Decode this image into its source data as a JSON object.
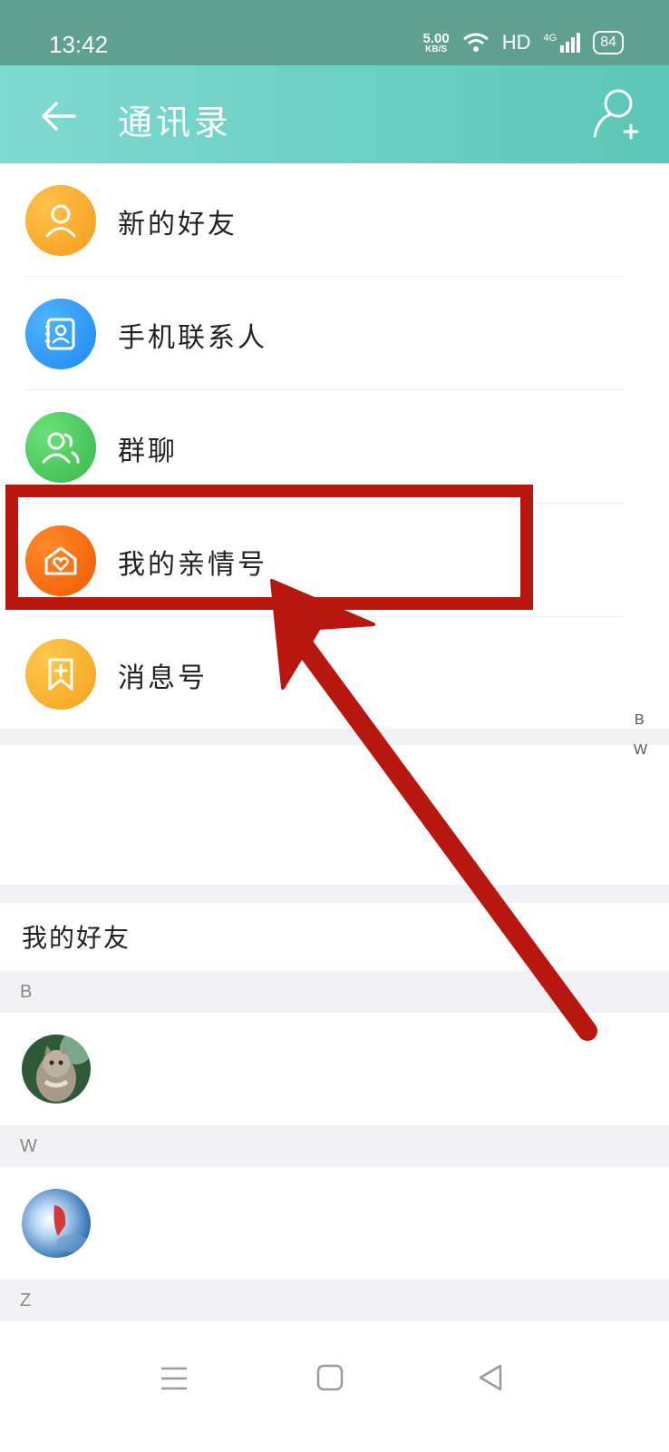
{
  "status_bar": {
    "time": "13:42",
    "net_speed": "5.00",
    "net_unit": "KB/S",
    "hd": "HD",
    "signal": "4G",
    "battery": "84"
  },
  "header": {
    "title": "通讯录",
    "back_icon": "arrow-left-icon",
    "add_icon": "add-contact-icon"
  },
  "menu": [
    {
      "label": "新的好友",
      "icon": "person-icon",
      "color": "#f5a623"
    },
    {
      "label": "手机联系人",
      "icon": "contact-book-icon",
      "color": "#2196f3"
    },
    {
      "label": "群聊",
      "icon": "group-icon",
      "color": "#4cca5c"
    },
    {
      "label": "我的亲情号",
      "icon": "home-heart-icon",
      "color": "#ff6a00"
    },
    {
      "label": "消息号",
      "icon": "bookmark-plus-icon",
      "color": "#f6a623"
    }
  ],
  "index_bar": [
    "B",
    "W"
  ],
  "friends_group": {
    "title": "我的好友",
    "sections": [
      {
        "letter": "B",
        "avatar": "kitten-avatar"
      },
      {
        "letter": "W",
        "avatar": "sky-avatar"
      },
      {
        "letter": "Z"
      }
    ]
  },
  "navbar": {
    "menu_icon": "menu-icon",
    "home_icon": "home-square-icon",
    "back_icon": "back-triangle-icon"
  },
  "colors": {
    "header_start": "#7fd9d3",
    "header_end": "#5cc7b6",
    "status_bar": "#5fa090",
    "annotation": "#b8170f"
  }
}
